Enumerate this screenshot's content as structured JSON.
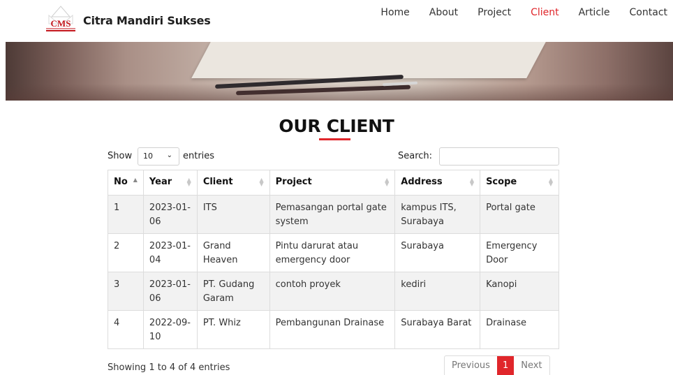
{
  "brand": {
    "logo_text": "CMS",
    "name": "Citra Mandiri Sukses"
  },
  "nav": [
    {
      "label": "Home",
      "active": false
    },
    {
      "label": "About",
      "active": false
    },
    {
      "label": "Project",
      "active": false
    },
    {
      "label": "Client",
      "active": true
    },
    {
      "label": "Article",
      "active": false
    },
    {
      "label": "Contact",
      "active": false
    }
  ],
  "colors": {
    "accent": "#e0262b",
    "text": "#222222",
    "row_stripe": "#f2f2f2",
    "border": "#dcdcdc"
  },
  "title": "OUR CLIENT",
  "controls": {
    "show_label": "Show",
    "length_value": "10",
    "entries_label": "entries",
    "search_label": "Search:",
    "search_value": ""
  },
  "table": {
    "columns": [
      "No",
      "Year",
      "Client",
      "Project",
      "Address",
      "Scope"
    ],
    "sorted_column": "No",
    "rows": [
      {
        "no": "1",
        "year": "2023-01-06",
        "client": "ITS",
        "project": "Pemasangan portal gate system",
        "address": "kampus ITS, Surabaya",
        "scope": "Portal gate"
      },
      {
        "no": "2",
        "year": "2023-01-04",
        "client": "Grand Heaven",
        "project": "Pintu darurat atau emergency door",
        "address": "Surabaya",
        "scope": "Emergency Door"
      },
      {
        "no": "3",
        "year": "2023-01-06",
        "client": "PT. Gudang Garam",
        "project": "contoh proyek",
        "address": "kediri",
        "scope": "Kanopi"
      },
      {
        "no": "4",
        "year": "2022-09-10",
        "client": "PT. Whiz",
        "project": "Pembangunan Drainase",
        "address": "Surabaya Barat",
        "scope": "Drainase"
      }
    ]
  },
  "footer": {
    "info": "Showing 1 to 4 of 4 entries",
    "previous": "Previous",
    "current_page": "1",
    "next": "Next"
  }
}
